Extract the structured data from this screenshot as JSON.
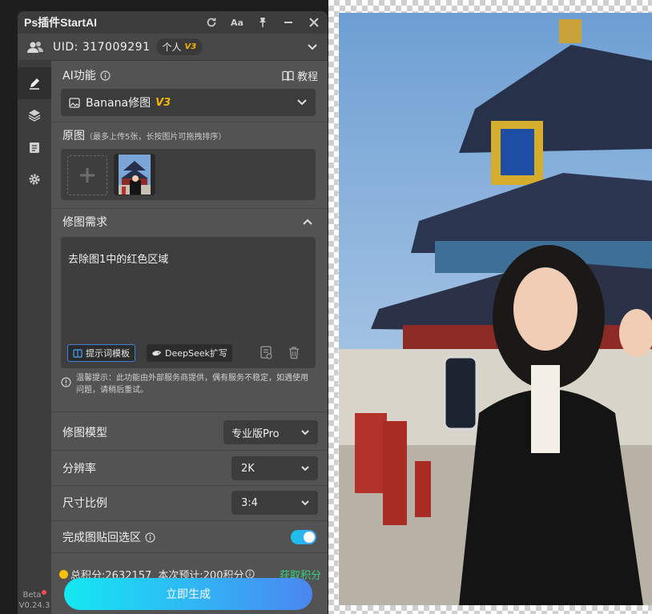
{
  "app": {
    "title": "Ps插件StartAI",
    "version_top": "Beta",
    "version_bottom": "V0.24.3"
  },
  "user": {
    "uid_label": "UID: 317009291",
    "plan": "个人",
    "plan_version": "V3"
  },
  "ai": {
    "section_label": "AI功能",
    "tutorial_label": "教程",
    "selected_feature": "Banana修图",
    "feature_version": "V3"
  },
  "source": {
    "label": "原图",
    "hint": "（最多上传5张，长按图片可拖拽排序）"
  },
  "requirement": {
    "label": "修图需求",
    "text": "去除图1中的红色区域",
    "template_chip": "提示词模板",
    "deepseek_chip": "DeepSeek扩写",
    "notice": "温馨提示：此功能由外部服务商提供，偶有服务不稳定，如遇使用问题，请稍后重试。"
  },
  "settings": {
    "model_label": "修图模型",
    "model_value": "专业版Pro",
    "resolution_label": "分辨率",
    "resolution_value": "2K",
    "ratio_label": "尺寸比例",
    "ratio_value": "3:4",
    "paste_label": "完成图贴回选区",
    "paste_enabled": true
  },
  "footer": {
    "credits_text": "总积分:2632157",
    "estimate_text": "本次预计:200积分",
    "get_credits": "获取积分",
    "generate_label": "立即生成"
  },
  "colors": {
    "accent_cyan": "#14e8f0",
    "accent_blue": "#4b86f0",
    "get_credits_green": "#35d07f",
    "version_orange": "#f4b400",
    "panel_bg": "#535353"
  }
}
